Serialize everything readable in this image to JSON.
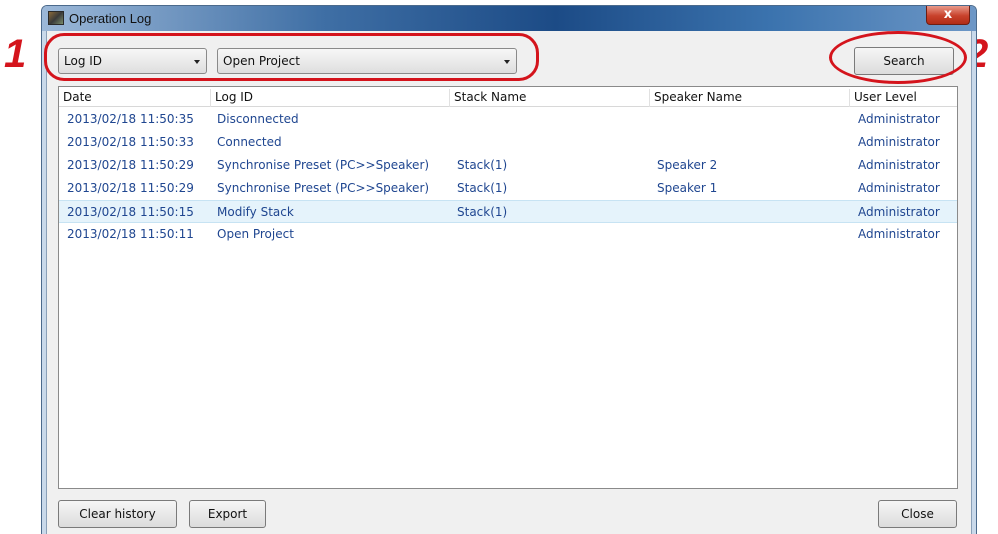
{
  "callouts": {
    "one": "1",
    "two": "2"
  },
  "window": {
    "title": "Operation Log",
    "close_glyph": "x"
  },
  "filter": {
    "field_selected": "Log ID",
    "value_selected": "Open Project"
  },
  "buttons": {
    "search": "Search",
    "clear_history": "Clear history",
    "export": "Export",
    "close": "Close"
  },
  "table": {
    "columns": [
      "Date",
      "Log ID",
      "Stack Name",
      "Speaker Name",
      "User Level"
    ],
    "rows": [
      {
        "date": "2013/02/18 11:50:35",
        "log_id": "Disconnected",
        "stack": "",
        "speaker": "",
        "level": "Administrator"
      },
      {
        "date": "2013/02/18 11:50:33",
        "log_id": "Connected",
        "stack": "",
        "speaker": "",
        "level": "Administrator"
      },
      {
        "date": "2013/02/18 11:50:29",
        "log_id": "Synchronise Preset (PC>>Speaker)",
        "stack": "Stack(1)",
        "speaker": "Speaker 2",
        "level": "Administrator"
      },
      {
        "date": "2013/02/18 11:50:29",
        "log_id": "Synchronise Preset (PC>>Speaker)",
        "stack": "Stack(1)",
        "speaker": "Speaker 1",
        "level": "Administrator"
      },
      {
        "date": "2013/02/18 11:50:15",
        "log_id": "Modify Stack",
        "stack": "Stack(1)",
        "speaker": "",
        "level": "Administrator",
        "selected": true
      },
      {
        "date": "2013/02/18 11:50:11",
        "log_id": "Open Project",
        "stack": "",
        "speaker": "",
        "level": "Administrator"
      }
    ]
  },
  "colors": {
    "row_text": "#1f4690",
    "selected_row": "#e5f3fb",
    "callout_red": "#d4141c"
  }
}
